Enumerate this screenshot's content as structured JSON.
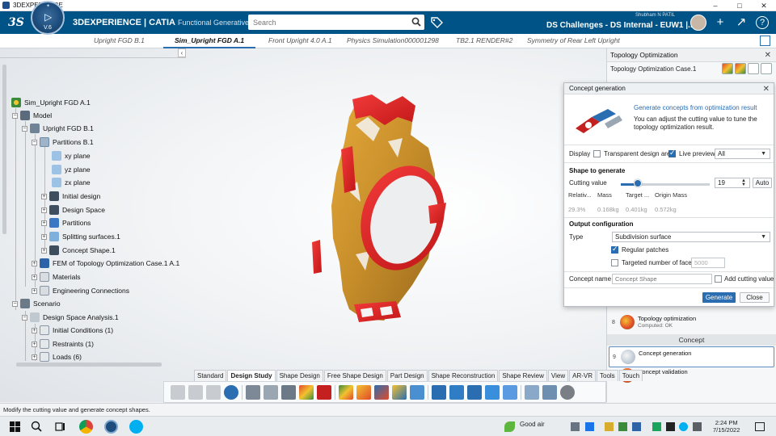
{
  "os": {
    "window_title": "3DEXPERIENCE",
    "controls": [
      "–",
      "□",
      "✕"
    ]
  },
  "header": {
    "ds_logo": "3S",
    "compass_version": "V.6",
    "compass_play": "▷",
    "brand_strong": "3DEXPERIENCE | CATIA",
    "brand_app": "Functional Generative Des...",
    "search_placeholder": "Search",
    "user_name": "Shubham N PATIL",
    "context": "DS Challenges - DS Internal - EUW1 |...",
    "context_caret": "⌄",
    "plus": "+",
    "share": "↗",
    "help": "?",
    "colors": {
      "header_bg": "#005386",
      "accent": "#2a6db0"
    }
  },
  "tabs": [
    {
      "label": "Upright FGD B.1"
    },
    {
      "label": "Sim_Upright FGD A.1"
    },
    {
      "label": "Front Upright 4.0 A.1"
    },
    {
      "label": "Physics Simulation000001298"
    },
    {
      "label": "TB2.1 RENDER#2"
    },
    {
      "label": "Symmetry of Rear Left Upright"
    }
  ],
  "tree": {
    "collapse": "‹",
    "nodes": [
      {
        "label": "Sim_Upright FGD A.1",
        "pm": ""
      },
      {
        "label": "Model",
        "pm": "−"
      },
      {
        "label": "Upright FGD B.1",
        "pm": "−"
      },
      {
        "label": "Partitions B.1",
        "pm": "−"
      },
      {
        "label": "xy plane",
        "pm": ""
      },
      {
        "label": "yz plane",
        "pm": ""
      },
      {
        "label": "zx plane",
        "pm": ""
      },
      {
        "label": "Initial design",
        "pm": "+"
      },
      {
        "label": "Design Space",
        "pm": "+"
      },
      {
        "label": "Partitions",
        "pm": "+"
      },
      {
        "label": "Splitting surfaces.1",
        "pm": "+"
      },
      {
        "label": "Concept Shape.1",
        "pm": "+"
      },
      {
        "label": "FEM of Topology Optimization Case.1 A.1",
        "pm": "+"
      },
      {
        "label": "Materials",
        "pm": "+"
      },
      {
        "label": "Engineering Connections",
        "pm": "+"
      },
      {
        "label": "Scenario",
        "pm": "−"
      },
      {
        "label": "Design Space Analysis.1",
        "pm": "−"
      },
      {
        "label": "Initial Conditions (1)",
        "pm": "+"
      },
      {
        "label": "Restraints (1)",
        "pm": "+"
      },
      {
        "label": "Loads (6)",
        "pm": "+"
      }
    ]
  },
  "topo_panel": {
    "title": "Topology Optimization",
    "close": "✕",
    "case_label": "Topology Optimization Case.1",
    "steps": [
      {
        "num": "8",
        "name": "Topology optimization",
        "status": "Computed: OK"
      },
      {
        "num": "9",
        "name": "Concept generation",
        "status": ""
      },
      {
        "num": "10",
        "name": "Concept validation",
        "status": ""
      }
    ],
    "concept_section": "Concept"
  },
  "dialog": {
    "title": "Concept generation",
    "close": "✕",
    "info_link": "Generate concepts from optimization result",
    "info_text": "You can adjust the cutting value to tune the topology optimization result.",
    "display_label": "Display",
    "transparent_label": "Transparent design area",
    "transparent_checked": false,
    "live_preview_label": "Live preview",
    "live_preview_checked": true,
    "display_select": "All",
    "shape_section": "Shape to generate",
    "cutting_label": "Cutting value",
    "cutting_value": "19",
    "cutting_slider_fraction": 0.19,
    "auto_button": "Auto",
    "mass_headers": [
      "Relativ...",
      "Mass",
      "Target ...",
      "Origin Mass"
    ],
    "mass_values": [
      "29.3%",
      "0.168kg",
      "0.401kg",
      "0.572kg"
    ],
    "output_section": "Output configuration",
    "type_label": "Type",
    "type_value": "Subdivision surface",
    "regular_patches_label": "Regular patches",
    "regular_patches_checked": true,
    "targeted_faces_label": "Targeted number of faces",
    "targeted_faces_checked": false,
    "targeted_faces_value": "5000",
    "concept_name_label": "Concept name",
    "concept_name_placeholder": "Concept Shape",
    "add_cutting_label": "Add cutting value",
    "add_cutting_checked": false,
    "generate_button": "Generate",
    "close_button": "Close"
  },
  "bottom_tabs": [
    {
      "label": "Standard"
    },
    {
      "label": "Design Study"
    },
    {
      "label": "Shape Design"
    },
    {
      "label": "Free Shape Design"
    },
    {
      "label": "Part Design"
    },
    {
      "label": "Shape Reconstruction"
    },
    {
      "label": "Shape Review"
    },
    {
      "label": "View"
    },
    {
      "label": "AR-VR"
    },
    {
      "label": "Tools"
    },
    {
      "label": "Touch"
    }
  ],
  "status_bar": {
    "message": "Modify the cutting value and generate concept shapes."
  },
  "taskbar": {
    "weather": "Good air",
    "time": "2:24 PM",
    "date": "7/15/2022"
  }
}
